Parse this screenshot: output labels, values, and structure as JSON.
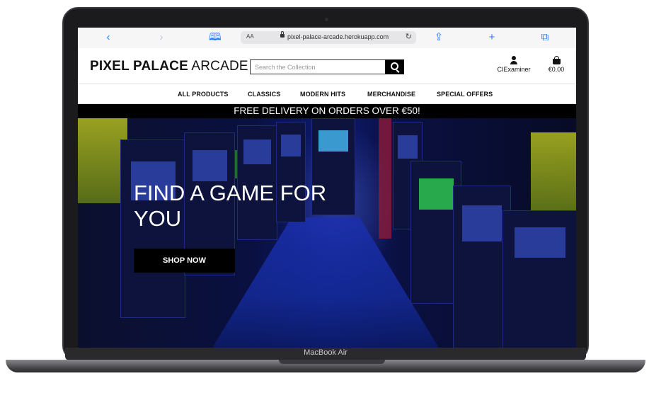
{
  "browser": {
    "text_size_label": "AA",
    "url": "pixel-palace-arcade.herokuapp.com",
    "icons": [
      "back-icon",
      "forward-icon",
      "bookmarks-icon",
      "lock-icon",
      "reload-icon",
      "share-icon",
      "add-tab-icon",
      "tabs-icon"
    ]
  },
  "site": {
    "logo_bold": "PIXEL PALACE",
    "logo_light": "ARCADE",
    "search_placeholder": "Search the Collection",
    "account_label": "CIExaminer",
    "cart_total": "€0.00"
  },
  "nav": {
    "items": [
      "ALL PRODUCTS",
      "CLASSICS",
      "MODERN HITS",
      "MERCHANDISE",
      "SPECIAL OFFERS"
    ]
  },
  "banner": {
    "text": "FREE DELIVERY ON ORDERS OVER €50!"
  },
  "hero": {
    "title": "FIND A GAME FOR YOU",
    "cta": "SHOP NOW"
  },
  "device": {
    "label": "MacBook Air"
  },
  "colors": {
    "accent": "#2a7bf6",
    "header_bg": "#ffffff",
    "banner_bg": "#000000",
    "hero_tint": "#1b2fae"
  }
}
